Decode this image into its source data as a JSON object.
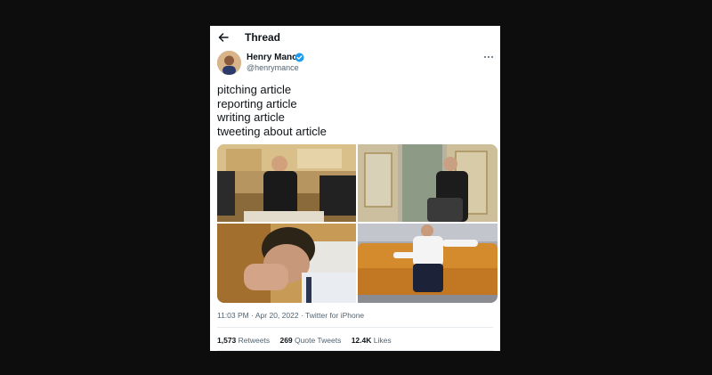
{
  "header": {
    "title": "Thread"
  },
  "tweet": {
    "author_name": "Henry Mance",
    "author_handle": "@henrymance",
    "lines": [
      "pitching article",
      "reporting article",
      "writing article",
      "tweeting about article"
    ],
    "time": "11:03 PM",
    "date": "Apr 20, 2022",
    "separator": "·",
    "source": "Twitter for iPhone"
  },
  "stats": {
    "retweets_count": "1,573",
    "retweets_label": "Retweets",
    "quotes_count": "269",
    "quotes_label": "Quote Tweets",
    "likes_count": "12.4K",
    "likes_label": "Likes"
  },
  "icons": {
    "back": "arrow-left-icon",
    "verified": "verified-badge-icon",
    "more": "more-horizontal-icon"
  },
  "colors": {
    "background": "#0d0d0d",
    "card": "#ffffff",
    "text": "#0f1419",
    "secondary": "#536471",
    "verified": "#1d9bf0"
  }
}
